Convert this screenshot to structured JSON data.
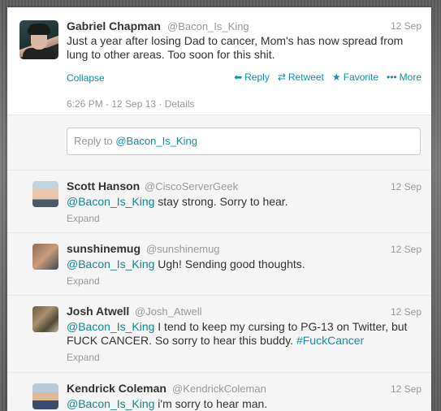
{
  "main_tweet": {
    "name": "Gabriel Chapman",
    "handle": "@Bacon_Is_King",
    "date": "12 Sep",
    "text_line1": "Just a year after losing Dad to cancer, Mom's has now spread from",
    "text_line2": "lung to other areas. Too soon for this shit.",
    "collapse_label": "Collapse",
    "actions": {
      "reply": "Reply",
      "retweet": "Retweet",
      "favorite": "Favorite",
      "more": "More"
    },
    "timestamp": "6:26 PM - 12 Sep 13 · Details"
  },
  "reply_box": {
    "placeholder_prefix": "Reply to ",
    "placeholder_mention": "@Bacon_Is_King"
  },
  "replies": [
    {
      "name": "Scott Hanson",
      "handle": "@CiscoServerGeek",
      "date": "12 Sep",
      "mention": "@Bacon_Is_King",
      "text": " stay strong. Sorry to hear.",
      "expand": "Expand"
    },
    {
      "name": "sunshinemug",
      "handle": "@sunshinemug",
      "date": "12 Sep",
      "mention": "@Bacon_Is_King",
      "text": " Ugh! Sending good thoughts.",
      "expand": "Expand"
    },
    {
      "name": "Josh Atwell",
      "handle": "@Josh_Atwell",
      "date": "12 Sep",
      "mention": "@Bacon_Is_King",
      "text": " I tend to keep my cursing to PG-13 on Twitter, but FUCK CANCER.  So sorry to hear this buddy. ",
      "hashtag": "#FuckCancer",
      "expand": "Expand"
    },
    {
      "name": "Kendrick Coleman",
      "handle": "@KendrickColeman",
      "date": "12 Sep",
      "mention": "@Bacon_Is_King",
      "text": " i'm sorry to hear man."
    }
  ],
  "colors": {
    "link": "#108ea3",
    "muted": "#999999",
    "reply_bg": "#f5f5f5"
  }
}
